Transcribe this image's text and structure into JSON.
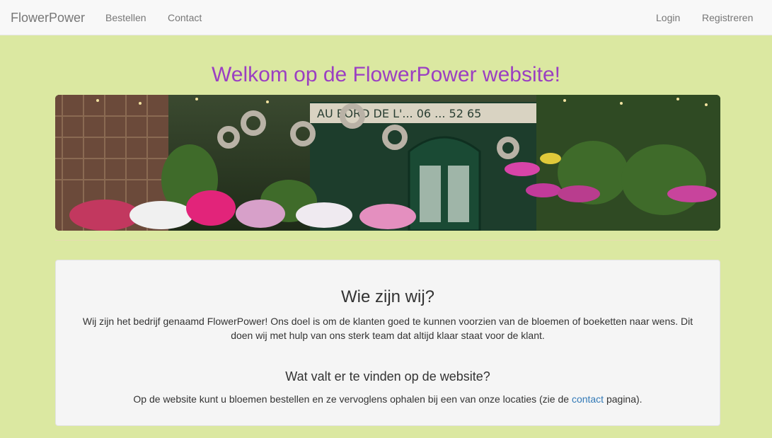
{
  "nav": {
    "brand": "FlowerPower",
    "order": "Bestellen",
    "contact": "Contact",
    "login": "Login",
    "register": "Registreren"
  },
  "page": {
    "title": "Welkom op de FlowerPower website!"
  },
  "hero": {
    "shop_sign": "AU BORD DE L'... 06 ... 52 65"
  },
  "about": {
    "heading": "Wie zijn wij?",
    "text": "Wij zijn het bedrijf genaamd FlowerPower! Ons doel is om de klanten goed te kunnen voorzien van de bloemen of boeketten naar wens. Dit doen wij met hulp van ons sterk team dat altijd klaar staat voor de klant."
  },
  "site": {
    "heading": "Wat valt er te vinden op de website?",
    "text_before": "Op de website kunt u bloemen bestellen en ze vervoglens ophalen bij een van onze locaties (zie de ",
    "link": "contact",
    "text_after": " pagina)."
  },
  "colors": {
    "background": "#dbe8a1",
    "title": "#9b3fc2",
    "link": "#337ab7"
  }
}
